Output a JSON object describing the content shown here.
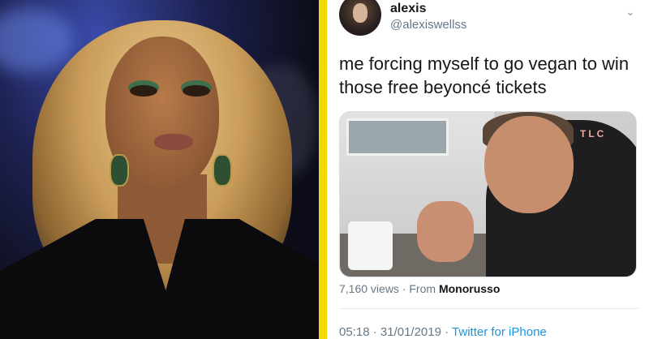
{
  "tweet": {
    "user_name": "alexis",
    "handle": "@alexiswellss",
    "text": "me forcing myself to go vegan to win those free beyoncé tickets",
    "media_watermark": "TLC",
    "views": "7,160 views",
    "from_prefix": "· From",
    "from_source": "Monorusso",
    "time": "05:18",
    "date": "31/01/2019",
    "client": "Twitter for iPhone",
    "dot": "·"
  },
  "icons": {
    "chevron": "chevron-down-icon"
  },
  "colors": {
    "divider": "#f2d900",
    "link": "#1b95e0",
    "secondary_text": "#657786"
  }
}
